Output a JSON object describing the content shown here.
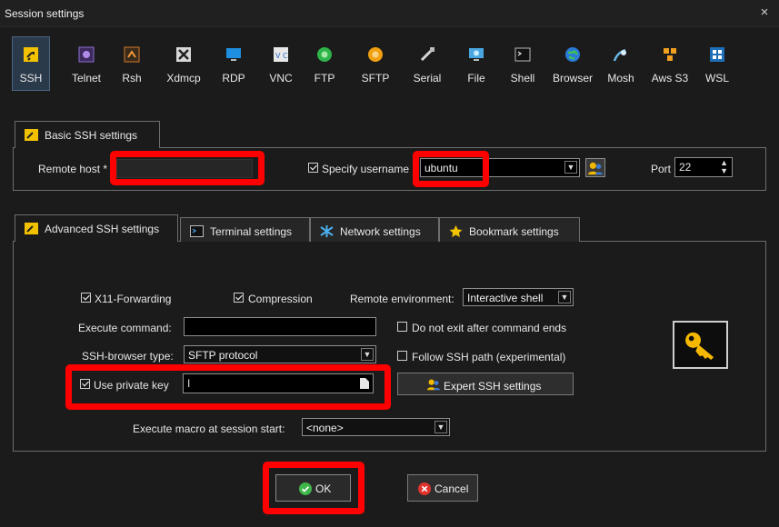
{
  "window": {
    "title": "Session settings",
    "close_glyph": "×"
  },
  "protocols": [
    {
      "label": "SSH",
      "icon": "ssh-icon",
      "active": true
    },
    {
      "label": "Telnet",
      "icon": "telnet-icon"
    },
    {
      "label": "Rsh",
      "icon": "rsh-icon"
    },
    {
      "label": "Xdmcp",
      "icon": "xdmcp-icon"
    },
    {
      "label": "RDP",
      "icon": "rdp-icon"
    },
    {
      "label": "VNC",
      "icon": "vnc-icon"
    },
    {
      "label": "FTP",
      "icon": "ftp-icon"
    },
    {
      "label": "SFTP",
      "icon": "sftp-icon"
    },
    {
      "label": "Serial",
      "icon": "serial-icon"
    },
    {
      "label": "File",
      "icon": "file-icon"
    },
    {
      "label": "Shell",
      "icon": "shell-icon"
    },
    {
      "label": "Browser",
      "icon": "browser-icon"
    },
    {
      "label": "Mosh",
      "icon": "mosh-icon"
    },
    {
      "label": "Aws S3",
      "icon": "aws-s3-icon"
    },
    {
      "label": "WSL",
      "icon": "wsl-icon"
    }
  ],
  "basic": {
    "tab_label": "Basic SSH settings",
    "remote_host_label": "Remote host *",
    "remote_host_value": "",
    "specify_username_label": "Specify username",
    "specify_username_checked": true,
    "username_value": "ubuntu",
    "port_label": "Port",
    "port_value": "22"
  },
  "tabs": [
    {
      "label": "Advanced SSH settings",
      "active": true
    },
    {
      "label": "Terminal settings"
    },
    {
      "label": "Network settings"
    },
    {
      "label": "Bookmark settings"
    }
  ],
  "advanced": {
    "x11_label": "X11-Forwarding",
    "x11_checked": true,
    "compression_label": "Compression",
    "compression_checked": true,
    "remote_env_label": "Remote environment:",
    "remote_env_value": "Interactive shell",
    "exec_cmd_label": "Execute command:",
    "exec_cmd_value": "",
    "do_not_exit_label": "Do not exit after command ends",
    "do_not_exit_checked": false,
    "ssh_browser_label": "SSH-browser type:",
    "ssh_browser_value": "SFTP protocol",
    "follow_path_label": "Follow SSH path (experimental)",
    "follow_path_checked": false,
    "private_key_label": "Use private key",
    "private_key_checked": true,
    "private_key_value": "I",
    "expert_label": "Expert SSH settings",
    "macro_label": "Execute macro at session start:",
    "macro_value": "<none>"
  },
  "buttons": {
    "ok": "OK",
    "cancel": "Cancel"
  },
  "colors": {
    "highlight": "#ff0000",
    "ok_green": "#3fb54a",
    "cancel_red": "#e0322d",
    "key_gold": "#f5b800"
  }
}
